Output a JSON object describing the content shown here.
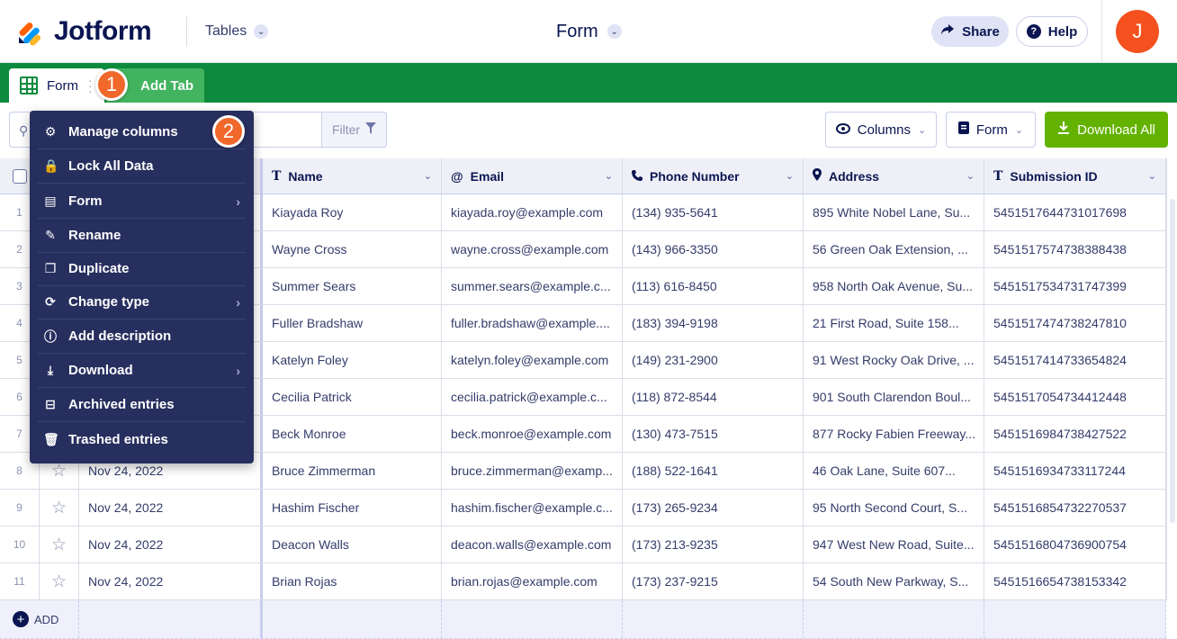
{
  "header": {
    "logo_text": "Jotform",
    "tables_label": "Tables",
    "form_title": "Form",
    "share_label": "Share",
    "help_label": "Help",
    "avatar_initial": "J"
  },
  "tabs": {
    "form_tab": "Form",
    "add_tab": "Add Tab"
  },
  "badges": [
    "1",
    "2"
  ],
  "toolbar": {
    "filter_label": "Filter",
    "columns_label": "Columns",
    "form_label": "Form",
    "download_label": "Download All"
  },
  "menu": {
    "items": [
      {
        "label": "Manage columns",
        "icon": "gear-icon"
      },
      {
        "label": "Lock All Data",
        "icon": "lock-icon"
      },
      {
        "label": "Form",
        "icon": "form-icon",
        "submenu": true
      },
      {
        "label": "Rename",
        "icon": "edit-icon"
      },
      {
        "label": "Duplicate",
        "icon": "duplicate-icon"
      },
      {
        "label": "Change type",
        "icon": "refresh-icon",
        "submenu": true
      },
      {
        "label": "Add description",
        "icon": "info-icon"
      },
      {
        "label": "Download",
        "icon": "download-icon",
        "submenu": true
      },
      {
        "label": "Archived entries",
        "icon": "archive-icon"
      },
      {
        "label": "Trashed entries",
        "icon": "trash-icon"
      }
    ]
  },
  "table": {
    "columns": [
      {
        "label": "Name",
        "icon": "text-icon"
      },
      {
        "label": "Email",
        "icon": "at-icon"
      },
      {
        "label": "Phone Number",
        "icon": "phone-icon"
      },
      {
        "label": "Address",
        "icon": "location-icon"
      },
      {
        "label": "Submission ID",
        "icon": "text-icon"
      }
    ],
    "rows": [
      {
        "num": "1",
        "date": "",
        "name": "Kiayada Roy",
        "email": "kiayada.roy@example.com",
        "phone": "(134) 935-5641",
        "address": "895 White Nobel Lane, Su...",
        "id": "5451517644731017698"
      },
      {
        "num": "2",
        "date": "",
        "name": "Wayne Cross",
        "email": "wayne.cross@example.com",
        "phone": "(143) 966-3350",
        "address": "56 Green Oak Extension, ...",
        "id": "5451517574738388438"
      },
      {
        "num": "3",
        "date": "",
        "name": "Summer Sears",
        "email": "summer.sears@example.c...",
        "phone": "(113) 616-8450",
        "address": "958 North Oak Avenue, Su...",
        "id": "5451517534731747399"
      },
      {
        "num": "4",
        "date": "",
        "name": "Fuller Bradshaw",
        "email": "fuller.bradshaw@example....",
        "phone": "(183) 394-9198",
        "address": "21 First Road, Suite 158...",
        "id": "5451517474738247810"
      },
      {
        "num": "5",
        "date": "",
        "name": "Katelyn Foley",
        "email": "katelyn.foley@example.com",
        "phone": "(149) 231-2900",
        "address": "91 West Rocky Oak Drive, ...",
        "id": "5451517414733654824"
      },
      {
        "num": "6",
        "date": "",
        "name": "Cecilia Patrick",
        "email": "cecilia.patrick@example.c...",
        "phone": "(118) 872-8544",
        "address": "901 South Clarendon Boul...",
        "id": "5451517054734412448"
      },
      {
        "num": "7",
        "date": "",
        "name": "Beck Monroe",
        "email": "beck.monroe@example.com",
        "phone": "(130) 473-7515",
        "address": "877 Rocky Fabien Freeway...",
        "id": "5451516984738427522"
      },
      {
        "num": "8",
        "date": "Nov 24, 2022",
        "name": "Bruce Zimmerman",
        "email": "bruce.zimmerman@examp...",
        "phone": "(188) 522-1641",
        "address": "46 Oak Lane, Suite 607...",
        "id": "5451516934733117244"
      },
      {
        "num": "9",
        "date": "Nov 24, 2022",
        "name": "Hashim Fischer",
        "email": "hashim.fischer@example.c...",
        "phone": "(173) 265-9234",
        "address": "95 North Second Court, S...",
        "id": "5451516854732270537"
      },
      {
        "num": "10",
        "date": "Nov 24, 2022",
        "name": "Deacon Walls",
        "email": "deacon.walls@example.com",
        "phone": "(173) 213-9235",
        "address": "947 West New Road, Suite...",
        "id": "5451516804736900754"
      },
      {
        "num": "11",
        "date": "Nov 24, 2022",
        "name": "Brian Rojas",
        "email": "brian.rojas@example.com",
        "phone": "(173) 237-9215",
        "address": "54 South New Parkway, S...",
        "id": "5451516654738153342"
      }
    ],
    "add_label": "ADD"
  }
}
